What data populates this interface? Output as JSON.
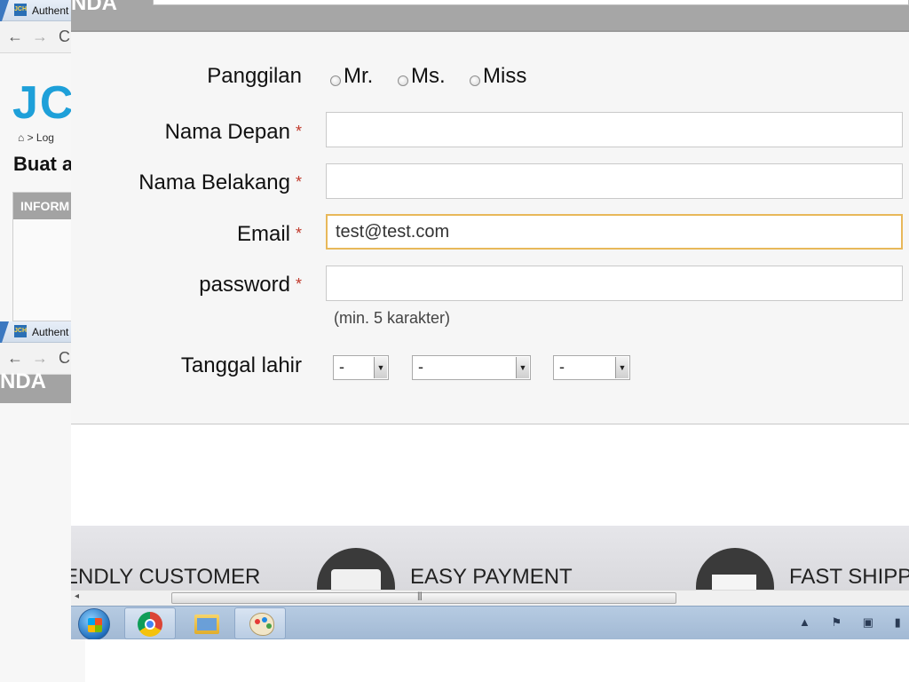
{
  "background_window": {
    "tab_label": "Authent",
    "breadcrumb": "> Log",
    "heading": "Buat a",
    "box_header": "INFORM",
    "logo_text": "JC",
    "bar2_text": "NDA",
    "nav": {
      "back": "←",
      "forward": "→",
      "reload": "C"
    }
  },
  "form": {
    "title_label": "Panggilan",
    "title_options": [
      "Mr.",
      "Ms.",
      "Miss"
    ],
    "first_name_label": "Nama Depan",
    "first_name_value": "",
    "last_name_label": "Nama Belakang",
    "last_name_value": "",
    "email_label": "Email",
    "email_value": "test@test.com",
    "password_label": "password",
    "password_value": "",
    "password_hint": "(min. 5 karakter)",
    "birthdate_label": "Tanggal lahir",
    "birthdate_day": "-",
    "birthdate_month": "-",
    "birthdate_year": "-",
    "required_mark": "*"
  },
  "features": {
    "customer": "ENDLY CUSTOMER",
    "payment": "EASY PAYMENT",
    "shipping": "FAST SHIPPI"
  },
  "scrollbar": {
    "left_arrow": "◂",
    "grip": "|||"
  },
  "taskbar": {
    "items": [
      "start-button",
      "chrome",
      "file-explorer",
      "paint"
    ],
    "tray": "▲ ⚑ ▣ ▮ ◀)"
  },
  "colors": {
    "accent_focus_border": "#e8b85a",
    "required_star": "#c0392b",
    "logo_blue": "#1ea0d9"
  }
}
